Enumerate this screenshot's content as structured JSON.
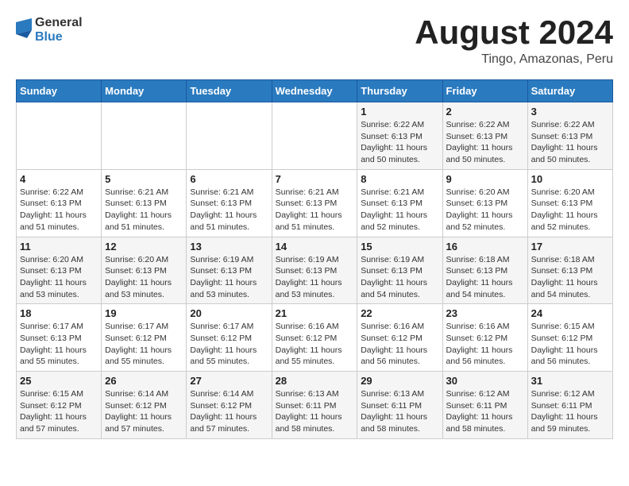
{
  "logo": {
    "text_general": "General",
    "text_blue": "Blue"
  },
  "title": {
    "month_year": "August 2024",
    "location": "Tingo, Amazonas, Peru"
  },
  "weekdays": [
    "Sunday",
    "Monday",
    "Tuesday",
    "Wednesday",
    "Thursday",
    "Friday",
    "Saturday"
  ],
  "weeks": [
    [
      {
        "day": "",
        "sunrise": "",
        "sunset": "",
        "daylight": ""
      },
      {
        "day": "",
        "sunrise": "",
        "sunset": "",
        "daylight": ""
      },
      {
        "day": "",
        "sunrise": "",
        "sunset": "",
        "daylight": ""
      },
      {
        "day": "",
        "sunrise": "",
        "sunset": "",
        "daylight": ""
      },
      {
        "day": "1",
        "sunrise": "Sunrise: 6:22 AM",
        "sunset": "Sunset: 6:13 PM",
        "daylight": "Daylight: 11 hours and 50 minutes."
      },
      {
        "day": "2",
        "sunrise": "Sunrise: 6:22 AM",
        "sunset": "Sunset: 6:13 PM",
        "daylight": "Daylight: 11 hours and 50 minutes."
      },
      {
        "day": "3",
        "sunrise": "Sunrise: 6:22 AM",
        "sunset": "Sunset: 6:13 PM",
        "daylight": "Daylight: 11 hours and 50 minutes."
      }
    ],
    [
      {
        "day": "4",
        "sunrise": "Sunrise: 6:22 AM",
        "sunset": "Sunset: 6:13 PM",
        "daylight": "Daylight: 11 hours and 51 minutes."
      },
      {
        "day": "5",
        "sunrise": "Sunrise: 6:21 AM",
        "sunset": "Sunset: 6:13 PM",
        "daylight": "Daylight: 11 hours and 51 minutes."
      },
      {
        "day": "6",
        "sunrise": "Sunrise: 6:21 AM",
        "sunset": "Sunset: 6:13 PM",
        "daylight": "Daylight: 11 hours and 51 minutes."
      },
      {
        "day": "7",
        "sunrise": "Sunrise: 6:21 AM",
        "sunset": "Sunset: 6:13 PM",
        "daylight": "Daylight: 11 hours and 51 minutes."
      },
      {
        "day": "8",
        "sunrise": "Sunrise: 6:21 AM",
        "sunset": "Sunset: 6:13 PM",
        "daylight": "Daylight: 11 hours and 52 minutes."
      },
      {
        "day": "9",
        "sunrise": "Sunrise: 6:20 AM",
        "sunset": "Sunset: 6:13 PM",
        "daylight": "Daylight: 11 hours and 52 minutes."
      },
      {
        "day": "10",
        "sunrise": "Sunrise: 6:20 AM",
        "sunset": "Sunset: 6:13 PM",
        "daylight": "Daylight: 11 hours and 52 minutes."
      }
    ],
    [
      {
        "day": "11",
        "sunrise": "Sunrise: 6:20 AM",
        "sunset": "Sunset: 6:13 PM",
        "daylight": "Daylight: 11 hours and 53 minutes."
      },
      {
        "day": "12",
        "sunrise": "Sunrise: 6:20 AM",
        "sunset": "Sunset: 6:13 PM",
        "daylight": "Daylight: 11 hours and 53 minutes."
      },
      {
        "day": "13",
        "sunrise": "Sunrise: 6:19 AM",
        "sunset": "Sunset: 6:13 PM",
        "daylight": "Daylight: 11 hours and 53 minutes."
      },
      {
        "day": "14",
        "sunrise": "Sunrise: 6:19 AM",
        "sunset": "Sunset: 6:13 PM",
        "daylight": "Daylight: 11 hours and 53 minutes."
      },
      {
        "day": "15",
        "sunrise": "Sunrise: 6:19 AM",
        "sunset": "Sunset: 6:13 PM",
        "daylight": "Daylight: 11 hours and 54 minutes."
      },
      {
        "day": "16",
        "sunrise": "Sunrise: 6:18 AM",
        "sunset": "Sunset: 6:13 PM",
        "daylight": "Daylight: 11 hours and 54 minutes."
      },
      {
        "day": "17",
        "sunrise": "Sunrise: 6:18 AM",
        "sunset": "Sunset: 6:13 PM",
        "daylight": "Daylight: 11 hours and 54 minutes."
      }
    ],
    [
      {
        "day": "18",
        "sunrise": "Sunrise: 6:17 AM",
        "sunset": "Sunset: 6:13 PM",
        "daylight": "Daylight: 11 hours and 55 minutes."
      },
      {
        "day": "19",
        "sunrise": "Sunrise: 6:17 AM",
        "sunset": "Sunset: 6:12 PM",
        "daylight": "Daylight: 11 hours and 55 minutes."
      },
      {
        "day": "20",
        "sunrise": "Sunrise: 6:17 AM",
        "sunset": "Sunset: 6:12 PM",
        "daylight": "Daylight: 11 hours and 55 minutes."
      },
      {
        "day": "21",
        "sunrise": "Sunrise: 6:16 AM",
        "sunset": "Sunset: 6:12 PM",
        "daylight": "Daylight: 11 hours and 55 minutes."
      },
      {
        "day": "22",
        "sunrise": "Sunrise: 6:16 AM",
        "sunset": "Sunset: 6:12 PM",
        "daylight": "Daylight: 11 hours and 56 minutes."
      },
      {
        "day": "23",
        "sunrise": "Sunrise: 6:16 AM",
        "sunset": "Sunset: 6:12 PM",
        "daylight": "Daylight: 11 hours and 56 minutes."
      },
      {
        "day": "24",
        "sunrise": "Sunrise: 6:15 AM",
        "sunset": "Sunset: 6:12 PM",
        "daylight": "Daylight: 11 hours and 56 minutes."
      }
    ],
    [
      {
        "day": "25",
        "sunrise": "Sunrise: 6:15 AM",
        "sunset": "Sunset: 6:12 PM",
        "daylight": "Daylight: 11 hours and 57 minutes."
      },
      {
        "day": "26",
        "sunrise": "Sunrise: 6:14 AM",
        "sunset": "Sunset: 6:12 PM",
        "daylight": "Daylight: 11 hours and 57 minutes."
      },
      {
        "day": "27",
        "sunrise": "Sunrise: 6:14 AM",
        "sunset": "Sunset: 6:12 PM",
        "daylight": "Daylight: 11 hours and 57 minutes."
      },
      {
        "day": "28",
        "sunrise": "Sunrise: 6:13 AM",
        "sunset": "Sunset: 6:11 PM",
        "daylight": "Daylight: 11 hours and 58 minutes."
      },
      {
        "day": "29",
        "sunrise": "Sunrise: 6:13 AM",
        "sunset": "Sunset: 6:11 PM",
        "daylight": "Daylight: 11 hours and 58 minutes."
      },
      {
        "day": "30",
        "sunrise": "Sunrise: 6:12 AM",
        "sunset": "Sunset: 6:11 PM",
        "daylight": "Daylight: 11 hours and 58 minutes."
      },
      {
        "day": "31",
        "sunrise": "Sunrise: 6:12 AM",
        "sunset": "Sunset: 6:11 PM",
        "daylight": "Daylight: 11 hours and 59 minutes."
      }
    ]
  ]
}
